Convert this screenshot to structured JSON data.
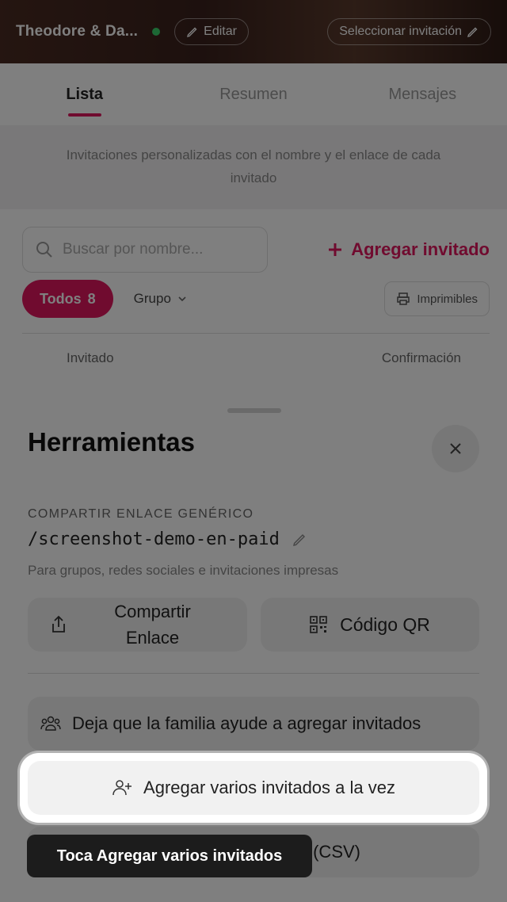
{
  "topbar": {
    "couple_name": "Theodore & Da...",
    "edit_label": "Editar",
    "select_label": "Seleccionar invitación"
  },
  "tabs": [
    {
      "label": "Lista",
      "active": true
    },
    {
      "label": "Resumen",
      "active": false
    },
    {
      "label": "Mensajes",
      "active": false
    }
  ],
  "info_band": "Invitaciones personalizadas con el nombre y el enlace de cada invitado",
  "search": {
    "placeholder": "Buscar por nombre..."
  },
  "add_guest_label": "Agregar invitado",
  "filters": {
    "all_label": "Todos",
    "all_count": "8",
    "group_label": "Grupo",
    "print_label": "Imprimibles"
  },
  "table": {
    "col_guest": "Invitado",
    "col_confirmation": "Confirmación"
  },
  "sheet": {
    "title": "Herramientas",
    "share_section_label": "COMPARTIR ENLACE GENÉRICO",
    "share_link": "/screenshot-demo-en-paid",
    "share_help": "Para grupos, redes sociales e invitaciones impresas",
    "share_button_line1": "Compartir",
    "share_button_line2": "Enlace",
    "qr_button": "Código QR",
    "family_button": "Deja que la familia ayude a agregar invitados",
    "bulk_button": "Agregar varios invitados a la vez",
    "csv_button_visible": "(CSV)"
  },
  "tooltip": "Toca Agregar varios invitados",
  "colors": {
    "accent": "#e0175e",
    "overlay": "rgba(0,0,0,0.5)",
    "button_bg": "#f1f1f1",
    "tooltip_bg": "#1c1c1c"
  },
  "icons": [
    "pencil-icon",
    "search-icon",
    "plus-icon",
    "printer-icon",
    "close-icon",
    "share-icon",
    "qr-code-icon",
    "group-icon",
    "add-user-icon",
    "chevron-down-icon"
  ]
}
